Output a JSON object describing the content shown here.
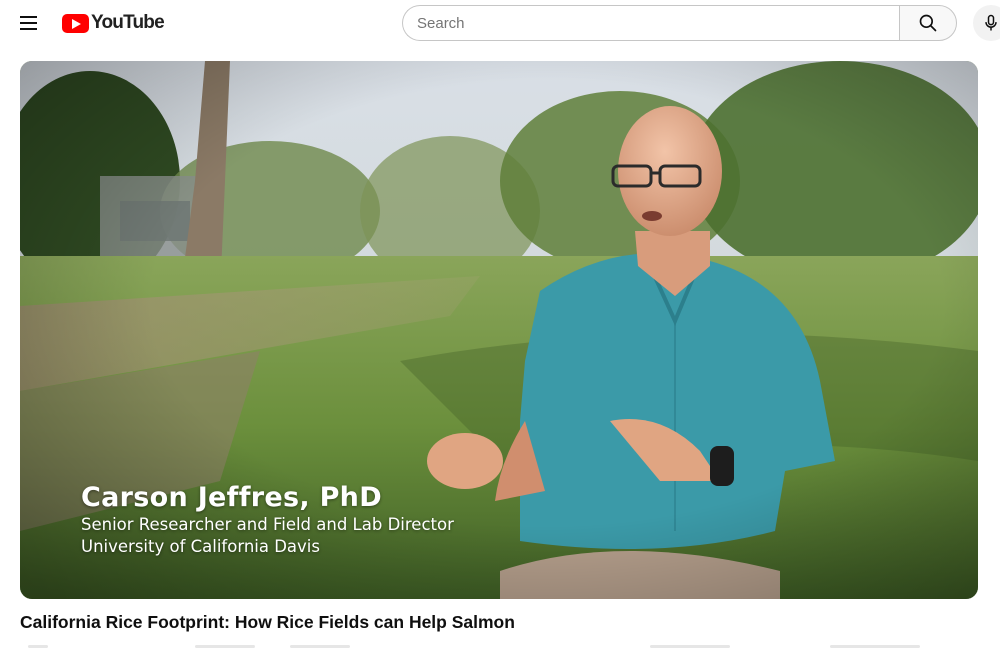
{
  "header": {
    "logo_text": "YouTube",
    "search_placeholder": "Search",
    "search_value": "",
    "icons": {
      "menu": "hamburger-menu-icon",
      "logo": "youtube-logo-icon",
      "search": "search-icon",
      "mic": "microphone-icon"
    },
    "brand_color": "#ff0000"
  },
  "player": {
    "lower_third": {
      "name": "Carson Jeffres, PhD",
      "role": "Senior Researcher and Field and Lab Director",
      "affiliation": "University of California Davis"
    }
  },
  "video": {
    "title": "California Rice Footprint: How Rice Fields can Help Salmon"
  }
}
